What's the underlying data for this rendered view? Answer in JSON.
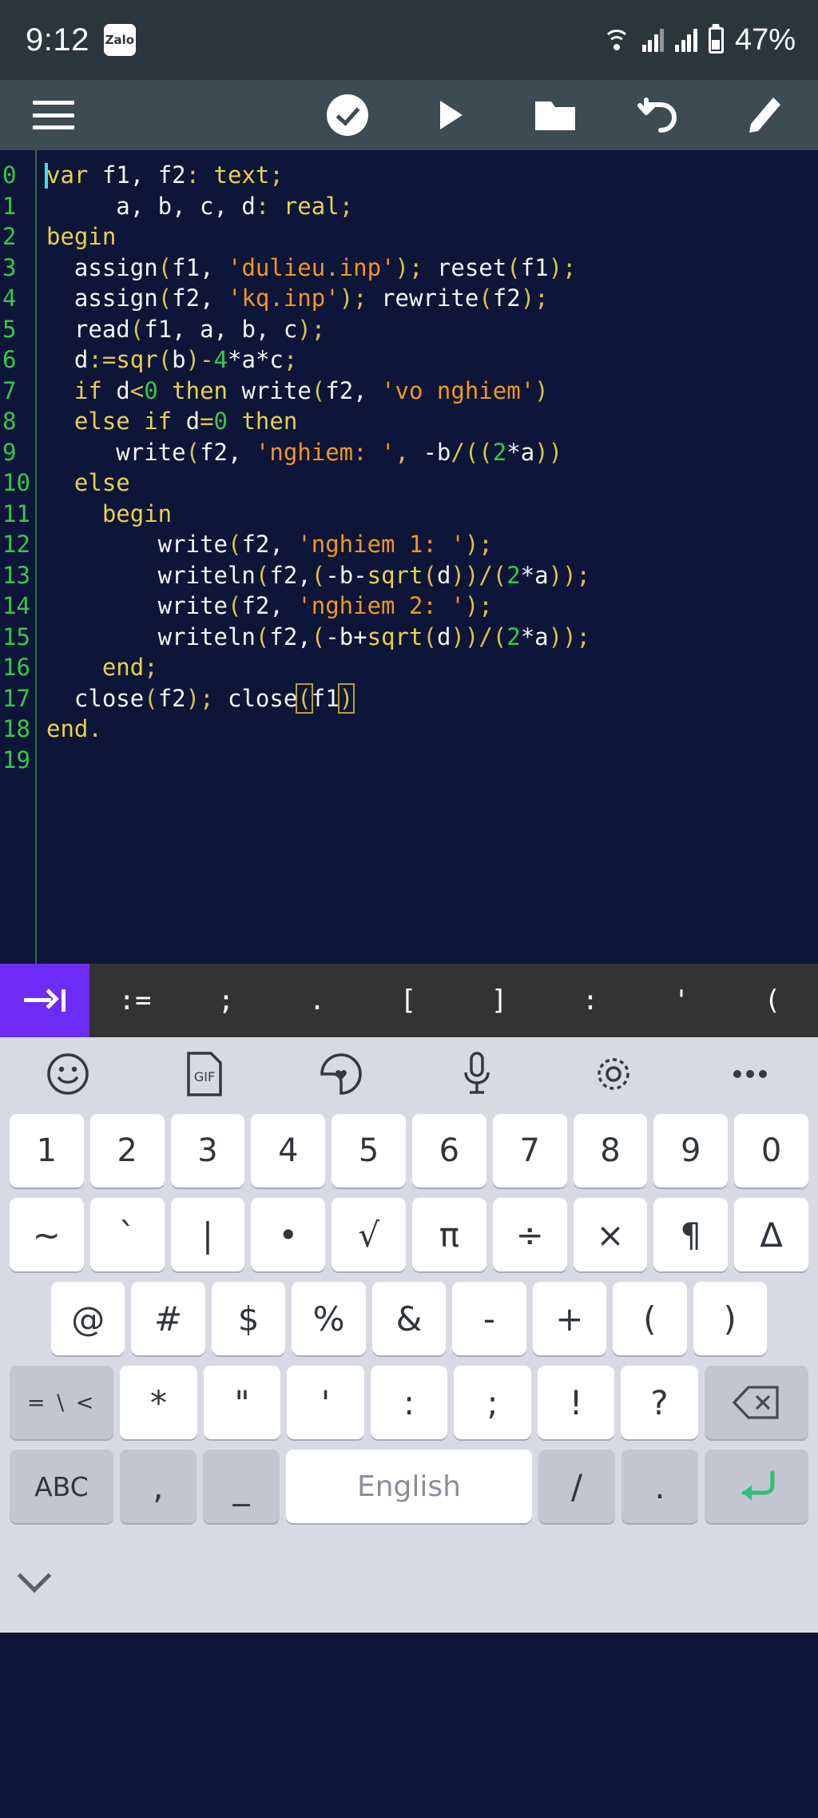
{
  "status_bar": {
    "time": "9:12",
    "app_badge": "Zalo",
    "battery_percent": "47%",
    "icons": [
      "wifi-icon",
      "signal-icon",
      "signal-icon",
      "battery-icon"
    ]
  },
  "toolbar": {
    "menu_label": "menu",
    "buttons": [
      {
        "name": "menu-button",
        "icon": "hamburger-icon"
      },
      {
        "name": "compile-button",
        "icon": "check-circle-icon"
      },
      {
        "name": "run-button",
        "icon": "play-icon"
      },
      {
        "name": "open-file-button",
        "icon": "folder-icon"
      },
      {
        "name": "undo-button",
        "icon": "undo-icon"
      },
      {
        "name": "edit-button",
        "icon": "pencil-icon"
      }
    ]
  },
  "editor": {
    "language": "pascal",
    "colors": {
      "background": "#0d1538",
      "keyword": "#e8d14a",
      "string": "#f0971e",
      "number": "#35c94a",
      "plain": "#f3f5f8",
      "punctuation": "#d9c34a",
      "line_number": "#35c94a",
      "caret": "#4fd8ef"
    },
    "lines": [
      {
        "num": "0",
        "text": "var f1, f2: text;"
      },
      {
        "num": "1",
        "text": "     a, b, c, d: real;"
      },
      {
        "num": "2",
        "text": "begin"
      },
      {
        "num": "3",
        "text": "  assign(f1, 'dulieu.inp'); reset(f1);"
      },
      {
        "num": "4",
        "text": "  assign(f2, 'kq.inp'); rewrite(f2);"
      },
      {
        "num": "5",
        "text": "  read(f1, a, b, c);"
      },
      {
        "num": "6",
        "text": "  d:=sqr(b)-4*a*c;"
      },
      {
        "num": "7",
        "text": "  if d<0 then write(f2, 'vo nghiem')"
      },
      {
        "num": "8",
        "text": "  else if d=0 then"
      },
      {
        "num": "9",
        "text": "     write(f2, 'nghiem: ', -b/(2*a))"
      },
      {
        "num": "10",
        "text": "  else"
      },
      {
        "num": "11",
        "text": "    begin"
      },
      {
        "num": "12",
        "text": "        write(f2, 'nghiem 1: ');"
      },
      {
        "num": "13",
        "text": "        writeln(f2,(-b-sqrt(d))/(2*a));"
      },
      {
        "num": "14",
        "text": "        write(f2, 'nghiem 2: ');"
      },
      {
        "num": "15",
        "text": "        writeln(f2,(-b+sqrt(d))/(2*a));"
      },
      {
        "num": "16",
        "text": "    end;"
      },
      {
        "num": "17",
        "text": "  close(f2); close(f1)"
      },
      {
        "num": "18",
        "text": "end."
      },
      {
        "num": "19",
        "text": ""
      }
    ]
  },
  "symbol_bar": {
    "tab_key": "tab-arrow-icon",
    "symbols": [
      ":=",
      ";",
      ".",
      "[",
      "]",
      ":",
      "'",
      "("
    ]
  },
  "keyboard": {
    "tools": [
      {
        "name": "emoji-icon",
        "label": "emoji"
      },
      {
        "name": "gif-icon",
        "label": "GIF"
      },
      {
        "name": "sticker-icon",
        "label": "sticker"
      },
      {
        "name": "microphone-icon",
        "label": "mic"
      },
      {
        "name": "gear-icon",
        "label": "settings"
      },
      {
        "name": "more-icon",
        "label": "more"
      }
    ],
    "rows": [
      [
        "1",
        "2",
        "3",
        "4",
        "5",
        "6",
        "7",
        "8",
        "9",
        "0"
      ],
      [
        "~",
        "`",
        "|",
        "•",
        "√",
        "π",
        "÷",
        "×",
        "¶",
        "Δ"
      ],
      [
        "@",
        "#",
        "$",
        "%",
        "&",
        "-",
        "+",
        "(",
        ")"
      ],
      [
        "= \\ <",
        "*",
        "\"",
        "'",
        ":",
        ";",
        "!",
        "?",
        "backspace-icon"
      ],
      [
        "ABC",
        ",",
        "_",
        "English",
        "/",
        ".",
        "enter-icon"
      ]
    ],
    "shift_label": "= \\ <",
    "abc_label": "ABC",
    "space_label": "English",
    "comma_label": ",",
    "underscore_label": "_",
    "slash_label": "/",
    "period_label": ".",
    "hide_keyboard": "chevron-down-icon"
  }
}
